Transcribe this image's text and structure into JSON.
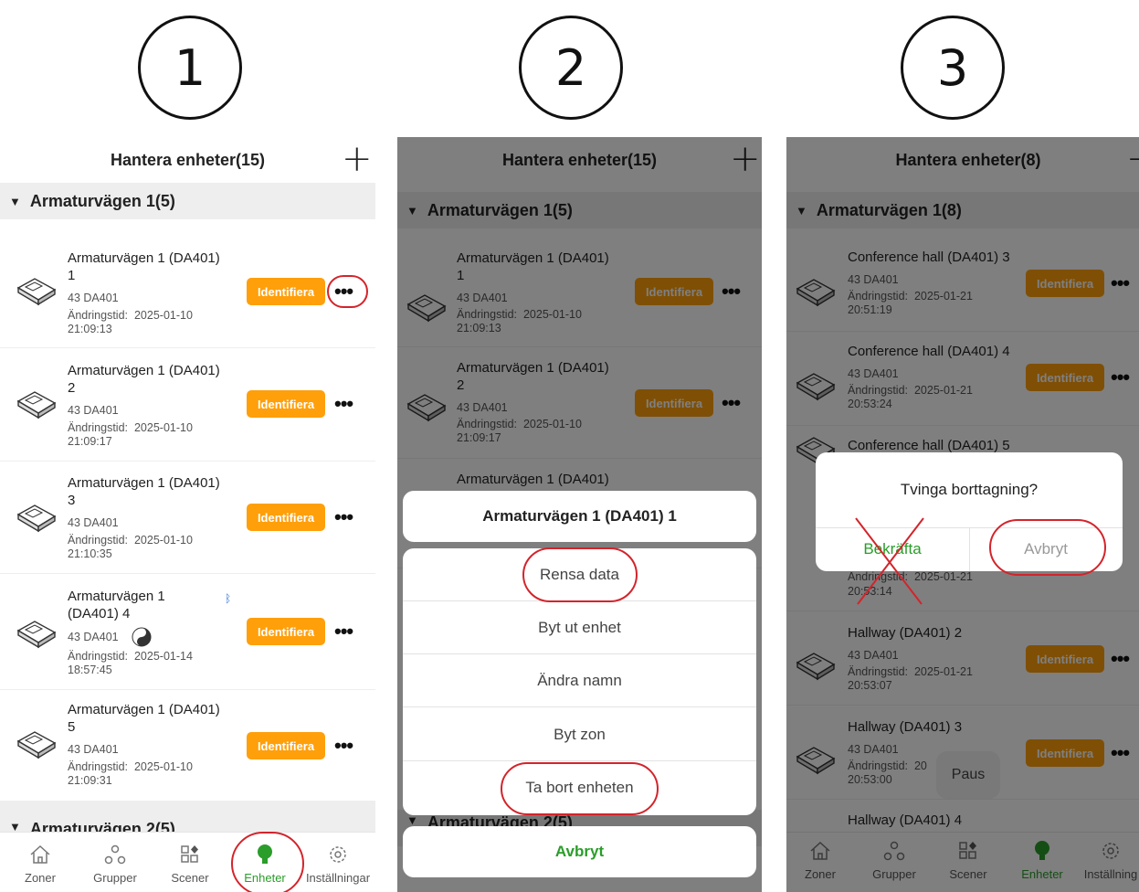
{
  "steps": [
    "1",
    "2",
    "3"
  ],
  "header_p1": "Hantera enheter(15)",
  "header_p2": "Hantera enheter(15)",
  "header_p3": "Hantera enheter(8)",
  "group1": "Armaturvägen 1(5)",
  "group2": "Armaturvägen 2(5)",
  "group3": "Armaturvägen 1(8)",
  "identify_label": "Identifiera",
  "dots": "•••",
  "model": "43 DA401",
  "changed_label": "Ändringstid:",
  "p1_items": [
    {
      "name1": "Armaturvägen 1 (DA401)",
      "name2": "1",
      "date": "2025-01-10",
      "time": "21:09:13"
    },
    {
      "name1": "Armaturvägen 1 (DA401)",
      "name2": "2",
      "date": "2025-01-10",
      "time": "21:09:17"
    },
    {
      "name1": "Armaturvägen 1 (DA401)",
      "name2": "3",
      "date": "2025-01-10",
      "time": "21:10:35"
    },
    {
      "name1": "Armaturvägen 1",
      "name2": "(DA401) 4",
      "date": "2025-01-14",
      "time": "18:57:45"
    },
    {
      "name1": "Armaturvägen 1 (DA401)",
      "name2": "5",
      "date": "2025-01-10",
      "time": "21:09:31"
    }
  ],
  "p2_items": [
    {
      "name1": "Armaturvägen 1 (DA401)",
      "name2": "1",
      "date": "2025-01-10",
      "time": "21:09:13"
    },
    {
      "name1": "Armaturvägen 1 (DA401)",
      "name2": "2",
      "date": "2025-01-10",
      "time": "21:09:17"
    },
    {
      "name1": "Armaturvägen 1 (DA401)"
    }
  ],
  "p3_items": [
    {
      "name": "Conference hall (DA401) 3",
      "date": "2025-01-21",
      "time": "20:51:19"
    },
    {
      "name": "Conference hall (DA401) 4",
      "date": "2025-01-21",
      "time": "20:53:24"
    },
    {
      "name": "Conference hall (DA401) 5",
      "date": "2025-01-21",
      "time": "20:53:14"
    },
    {
      "name": "Hallway (DA401) 2",
      "date": "2025-01-21",
      "time": "20:53:07"
    },
    {
      "name": "Hallway (DA401) 3",
      "date": "20",
      "time": "20:53:00"
    },
    {
      "name": "Hallway (DA401) 4"
    }
  ],
  "action_sheet": {
    "title": "Armaturvägen 1 (DA401) 1",
    "options": [
      "Rensa data",
      "Byt ut enhet",
      "Ändra namn",
      "Byt zon",
      "Ta bort enheten"
    ],
    "cancel": "Avbryt"
  },
  "dialog": {
    "title": "Tvinga borttagning?",
    "confirm": "Bekräfta",
    "cancel": "Avbryt"
  },
  "toast": "Paus",
  "nav": [
    "Zoner",
    "Grupper",
    "Scener",
    "Enheter",
    "Inställningar"
  ],
  "nav_p3_last": "Inställning",
  "colors": {
    "identify": "#ff9f0a",
    "accent_green": "#2a9d2a",
    "annotation_red": "#d3242b"
  }
}
